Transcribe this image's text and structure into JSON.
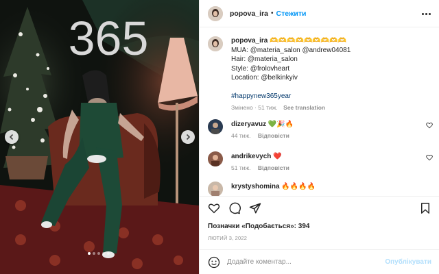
{
  "post": {
    "username": "popova_ira",
    "separator": "•",
    "follow_label": "Стежити",
    "image_overlay_text": "365",
    "carousel": {
      "slide_count": 5,
      "active_index": 0
    }
  },
  "caption": {
    "username": "popova_ira",
    "title_emoji": "🫶🫶🫶🫶🫶🫶🫶🫶🫶",
    "lines": [
      "MUA: @materia_salon @andrew04081",
      "Hair: @materia_salon",
      "Style: @frolovheart",
      "Location: @belkinkyiv"
    ],
    "hashtag": "#happynew365year",
    "meta": "Змінено · 51 тиж.",
    "translate": "See translation"
  },
  "comments": [
    {
      "username": "dizeryavuz",
      "text": "💚🎉🔥",
      "time": "44 тиж.",
      "reply": "Відповісти"
    },
    {
      "username": "andrikevych",
      "text": "❤️",
      "time": "51 тиж.",
      "reply": "Відповісти"
    },
    {
      "username": "krystyshomina",
      "text": "🔥🔥🔥🔥",
      "time": "",
      "reply": ""
    }
  ],
  "likes": {
    "label": "Позначки «Подобається»:",
    "count": "394"
  },
  "date": "ЛЮТИЙ 3, 2022",
  "add_comment": {
    "placeholder": "Додайте коментар...",
    "post_label": "Опублікувати"
  },
  "colors": {
    "accent": "#0095f6",
    "post_disabled": "#b2dffc",
    "muted": "#8e8e8e",
    "link": "#00376b"
  },
  "icons": [
    "chevron-left-icon",
    "chevron-right-icon",
    "more-icon",
    "heart-icon",
    "comment-icon",
    "share-icon",
    "bookmark-icon",
    "emoji-icon"
  ]
}
